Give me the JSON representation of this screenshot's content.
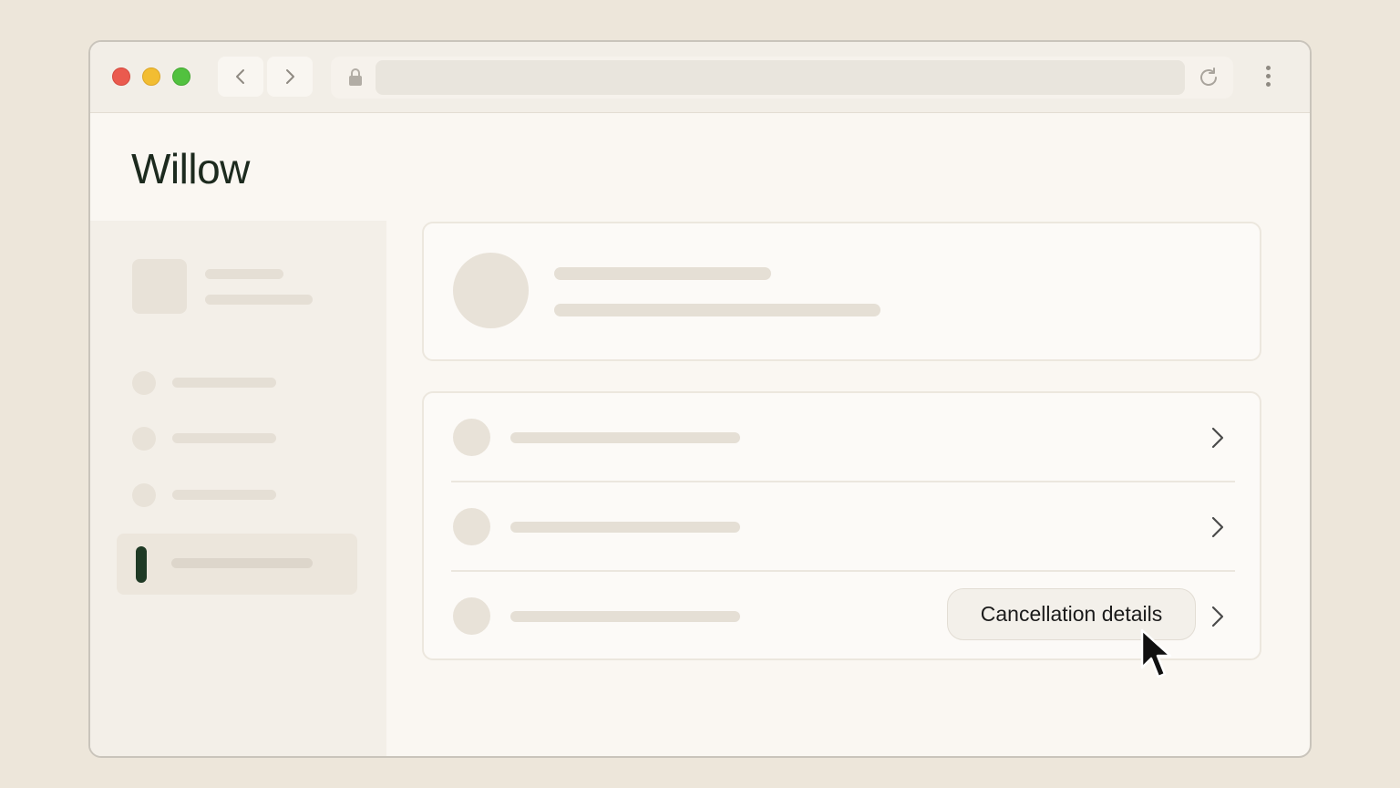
{
  "app": {
    "title": "Willow"
  },
  "browser": {
    "address": ""
  },
  "list": {
    "rows": [
      {
        "action_label": ""
      },
      {
        "action_label": ""
      },
      {
        "action_label": "Cancellation details"
      }
    ]
  },
  "colors": {
    "accent": "#1f3a25",
    "background": "#ede6da",
    "window": "#faf7f2"
  },
  "icons": [
    "back-arrow-icon",
    "forward-arrow-icon",
    "lock-icon",
    "reload-icon",
    "more-vertical-icon",
    "chevron-right-icon",
    "mouse-cursor-icon"
  ]
}
